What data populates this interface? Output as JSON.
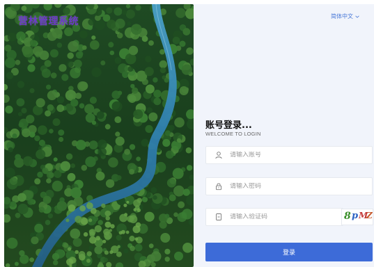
{
  "brand": {
    "title": "营林管理系统"
  },
  "language": {
    "label": "简体中文"
  },
  "login": {
    "title": "账号登录...",
    "subtitle": "WELCOME TO LOGIN",
    "account_placeholder": "请输入账号",
    "password_placeholder": "请输入密码",
    "captcha_placeholder": "请输入验证码",
    "captcha_chars": [
      "8",
      "p",
      "M",
      "Z"
    ],
    "submit_label": "登录"
  },
  "colors": {
    "brand": "#6b39c8",
    "accent": "#3d6bd8",
    "link": "#4c7ad8",
    "panel_bg": "#f1f4fb"
  },
  "icons": {
    "account": "user-icon",
    "password": "lock-icon",
    "captcha": "shield-icon",
    "language": "chevron-down-icon"
  }
}
